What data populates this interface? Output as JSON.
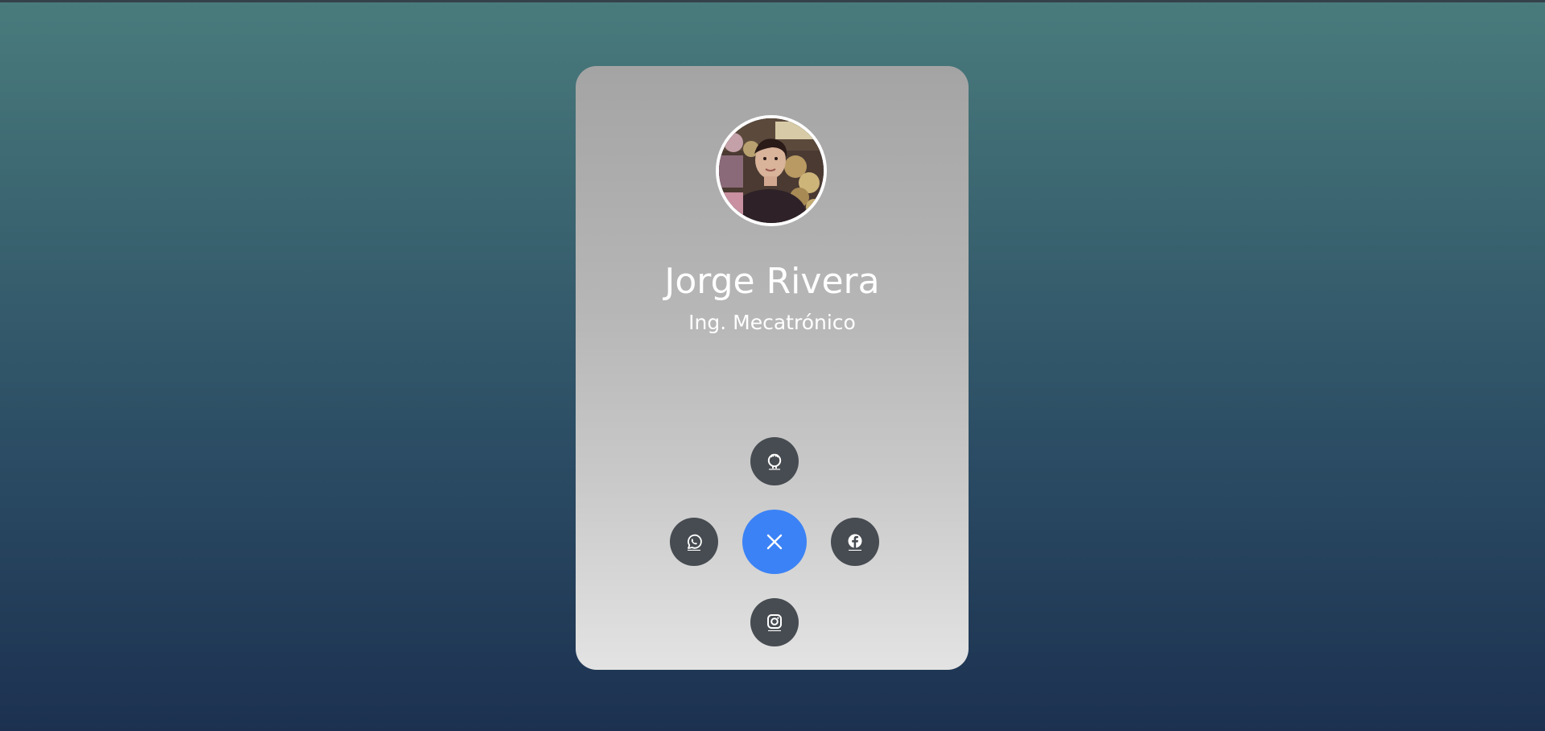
{
  "profile": {
    "name": "Jorge Rivera",
    "role": "Ing. Mecatrónico",
    "avatar_alt": "profile-photo"
  },
  "social_menu": {
    "items": [
      {
        "icon": "github-icon",
        "position": "top"
      },
      {
        "icon": "whatsapp-icon",
        "position": "left"
      },
      {
        "icon": "facebook-icon",
        "position": "right"
      },
      {
        "icon": "instagram-icon",
        "position": "bottom"
      }
    ],
    "toggle_icon": "close-icon"
  },
  "colors": {
    "toggle": "#3b82f6",
    "social_button": "#474c52",
    "text": "#ffffff",
    "avatar_border": "#ffffff"
  }
}
